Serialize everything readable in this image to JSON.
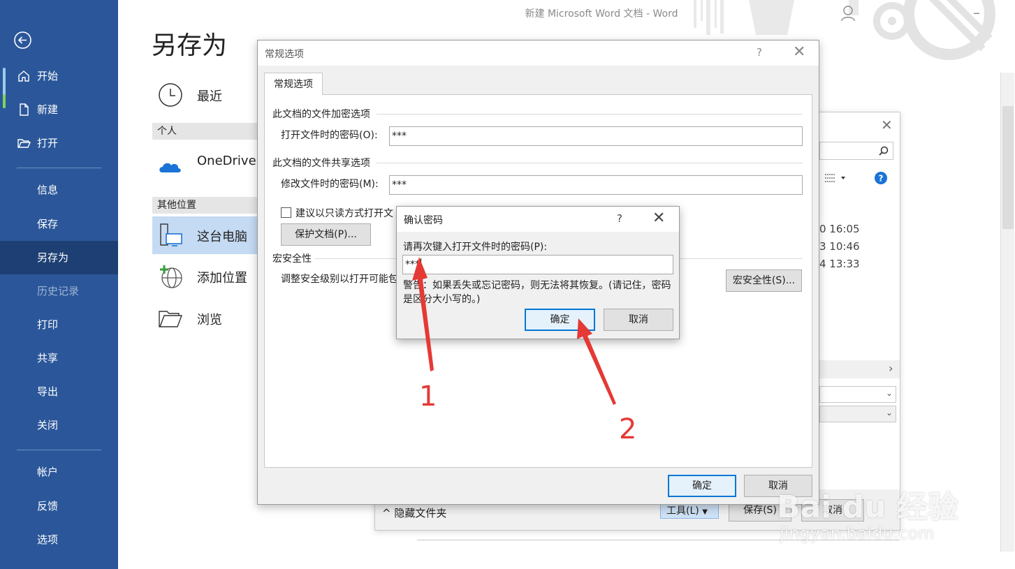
{
  "window": {
    "title": "新建 Microsoft Word 文档  -  Word"
  },
  "sidebar": {
    "top": [
      {
        "label": "开始",
        "icon": "home-icon"
      },
      {
        "label": "新建",
        "icon": "new-document-icon"
      },
      {
        "label": "打开",
        "icon": "open-folder-icon"
      }
    ],
    "middle": [
      {
        "label": "信息"
      },
      {
        "label": "保存"
      },
      {
        "label": "另存为",
        "active": true
      },
      {
        "label": "历史记录",
        "disabled": true
      },
      {
        "label": "打印"
      },
      {
        "label": "共享"
      },
      {
        "label": "导出"
      },
      {
        "label": "关闭"
      }
    ],
    "bottom": [
      {
        "label": "帐户"
      },
      {
        "label": "反馈"
      },
      {
        "label": "选项"
      }
    ]
  },
  "save_as": {
    "title": "另存为",
    "recent": "最近",
    "personal_header": "个人",
    "onedrive": "OneDrive",
    "other_header": "其他位置",
    "this_pc": "这台电脑",
    "add_place": "添加位置",
    "browse": "浏览"
  },
  "file_dialog": {
    "timestamps": [
      "0 16:05",
      "3 10:46",
      "4 13:33"
    ],
    "hide_folders": "隐藏文件夹",
    "tools": "工具(L)",
    "save": "保存(S)",
    "cancel": "取消"
  },
  "general_options": {
    "title": "常规选项",
    "tab": "常规选项",
    "encrypt_group": "此文档的文件加密选项",
    "open_password_label": "打开文件时的密码(O):",
    "open_password_value": "***",
    "share_group": "此文档的文件共享选项",
    "modify_password_label": "修改文件时的密码(M):",
    "modify_password_value": "***",
    "readonly_checkbox": "建议以只读方式打开文",
    "protect_button": "保护文档(P)...",
    "macro_group": "宏安全性",
    "macro_text": "调整安全级别以打开可能包",
    "macro_button": "宏安全性(S)...",
    "ok": "确定",
    "cancel": "取消"
  },
  "confirm_password": {
    "title": "确认密码",
    "prompt": "请再次键入打开文件时的密码(P):",
    "value": "***",
    "warning": "警告：如果丢失或忘记密码，则无法将其恢复。(请记住，密码是区分大小写的。)",
    "ok": "确定",
    "cancel": "取消"
  },
  "annotations": {
    "step1": "1",
    "step2": "2",
    "accent": "#e53935"
  },
  "watermark": {
    "brand": "Bai du 经验",
    "url": "jingyan.baidu.com"
  }
}
